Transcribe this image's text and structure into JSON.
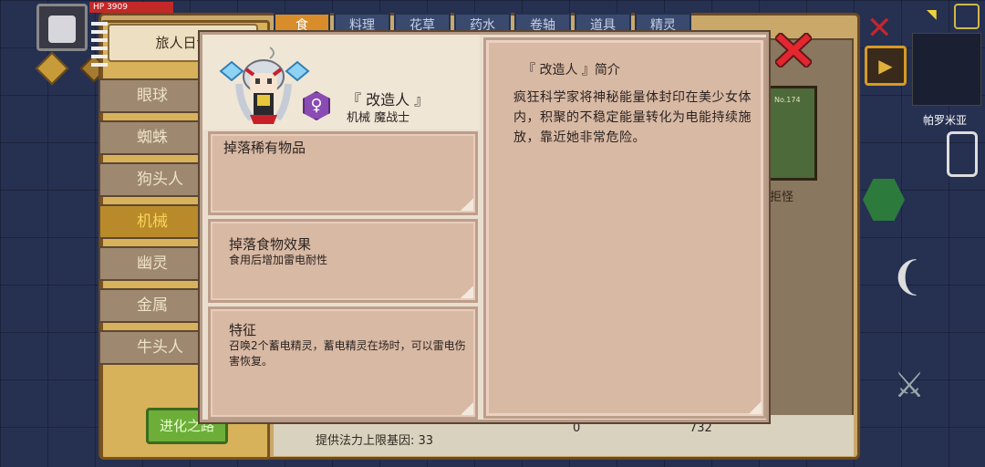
{
  "hud": {
    "hp_label": "HP",
    "hp_value": "3909"
  },
  "journal": {
    "title": "旅人日记",
    "categories": [
      "眼球",
      "蜘蛛",
      "狗头人",
      "机械",
      "幽灵",
      "金属",
      "牛头人"
    ],
    "active_category": "机械",
    "evolve_button": "进化之路",
    "top_tabs": [
      "食",
      "料理",
      "花草",
      "药水",
      "卷轴",
      "道具",
      "精灵"
    ],
    "card_label": "拒怪",
    "stats": {
      "mana_gene": "提供法力上限基因: 33",
      "count_a": "0",
      "count_b": "732"
    },
    "card_number": "No.174"
  },
  "map": {
    "location_name": "帕罗米亚"
  },
  "modal": {
    "monster_name": "『 改造人 』",
    "monster_type": "机械 魔战士",
    "gender_symbol": "♀",
    "sections": [
      {
        "title": "掉落稀有物品",
        "body": ""
      },
      {
        "title": "掉落食物效果",
        "body": "食用后增加雷电耐性"
      },
      {
        "title": "特征",
        "body": "召唤2个蓄电精灵，蓄电精灵在场时，可以雷电伤害恢复。"
      }
    ],
    "desc_title": "『 改造人 』简介",
    "desc_body": "疯狂科学家将神秘能量体封印在美少女体内，积聚的不稳定能量转化为电能持续施放，靠近她非常危险。"
  },
  "colors": {
    "accent_red": "#e4262f",
    "panel_tan": "#d8b9a4",
    "panel_border": "#bd9e8a",
    "gender_purple": "#8a4bb3"
  },
  "icons": {
    "close": "close-x-icon",
    "gender": "female-icon",
    "portrait": "cyborg-girl-portrait"
  }
}
